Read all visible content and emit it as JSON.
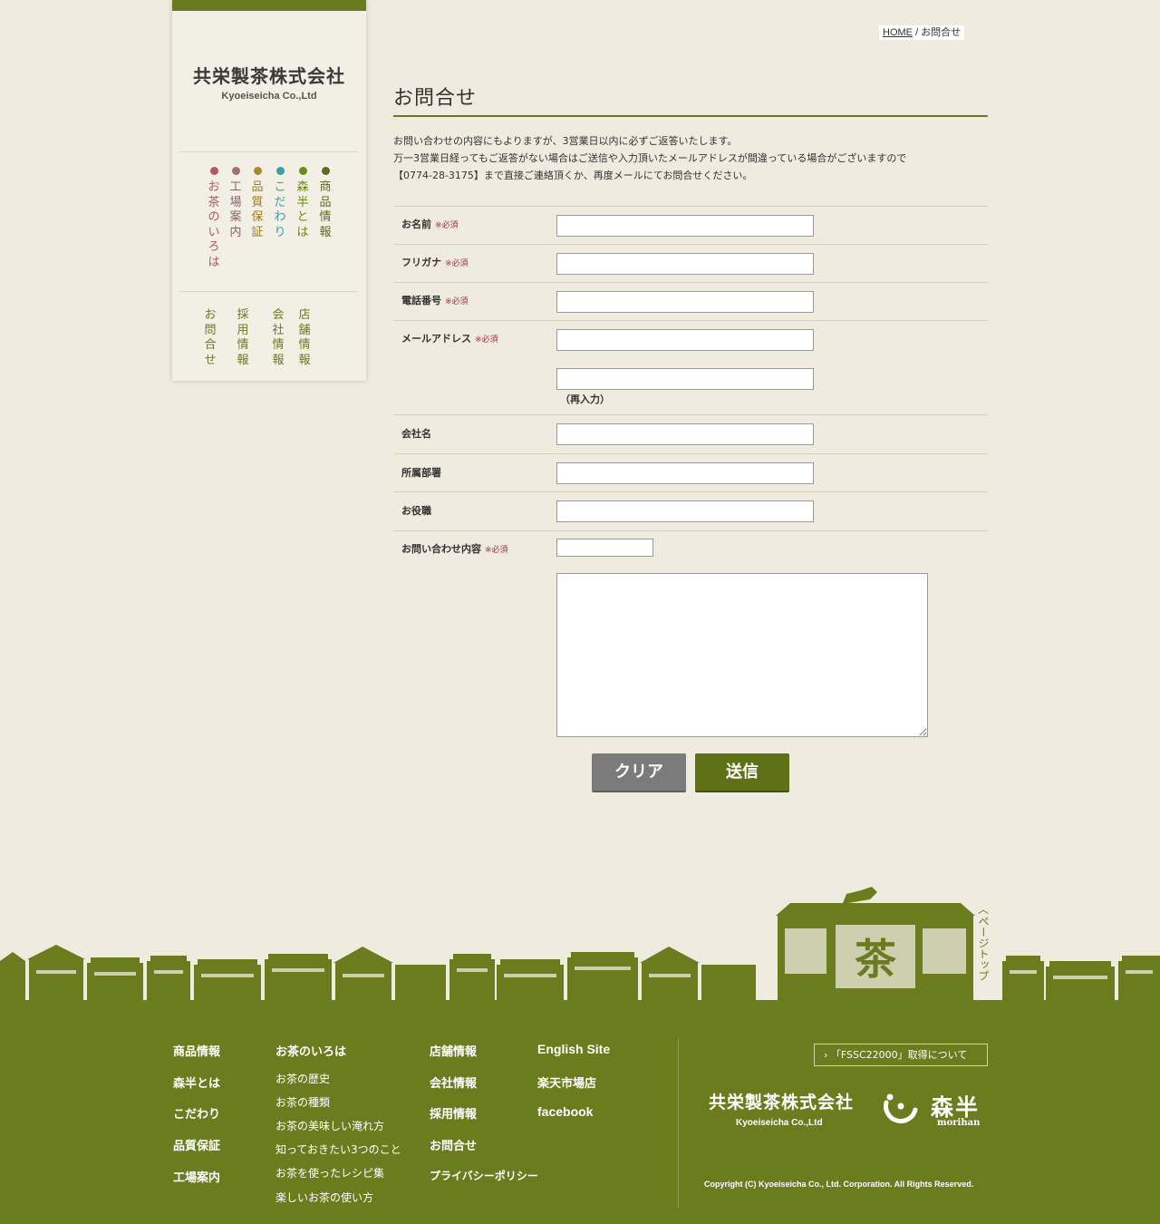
{
  "sidebar": {
    "logo_ja": "共栄製茶株式会社",
    "logo_en": "Kyoeiseicha Co.,Ltd",
    "nav_primary": [
      {
        "label": "お茶のいろは",
        "color": "#b25a5a"
      },
      {
        "label": "工場案内",
        "color": "#a0707a"
      },
      {
        "label": "品質保証",
        "color": "#b08a2a"
      },
      {
        "label": "こだわり",
        "color": "#3aa0a8"
      },
      {
        "label": "森半とは",
        "color": "#6a8a1a"
      },
      {
        "label": "商品情報",
        "color": "#5b6a1f"
      }
    ],
    "nav_secondary": [
      "お問合せ",
      "採用情報",
      "会社情報",
      "店舗情報"
    ]
  },
  "breadcrumb": {
    "home": "HOME",
    "sep": "/",
    "current": "お問合せ"
  },
  "page_title": "お問合せ",
  "intro": [
    "お問い合わせの内容にもよりますが、3営業日以内に必ずご返答いたします。",
    "万一3営業日経ってもご返答がない場合はご送信や入力頂いたメールアドレスが間違っている場合がございますので",
    "【0774-28-3175】まで直接ご連絡頂くか、再度メールにてお問合せください。"
  ],
  "form": {
    "required_mark": "※必須",
    "fields": {
      "name": "お名前",
      "kana": "フリガナ",
      "phone": "電話番号",
      "email": "メールアドレス",
      "reinput": "（再入力）",
      "company": "会社名",
      "department": "所属部署",
      "position": "お役職",
      "inquiry": "お問い合わせ内容"
    },
    "values": {
      "name": "",
      "kana": "",
      "phone": "",
      "email": "",
      "email_confirm": "",
      "company": "",
      "department": "",
      "position": "",
      "inquiry_type": "",
      "message": ""
    },
    "clear_label": "クリア",
    "send_label": "送信"
  },
  "pagetop": "ページトップ",
  "footer": {
    "col1": [
      "商品情報",
      "森半とは",
      "こだわり",
      "品質保証",
      "工場案内"
    ],
    "col2_title": "お茶のいろは",
    "col2": [
      "お茶の歴史",
      "お茶の種類",
      "お茶の美味しい淹れ方",
      "知っておきたい3つのこと",
      "お茶を使ったレシピ集",
      "楽しいお茶の使い方"
    ],
    "col3": [
      "店舗情報",
      "会社情報",
      "採用情報",
      "お問合せ",
      "プライバシーポリシー"
    ],
    "col4": [
      "English Site",
      "楽天市場店",
      "facebook"
    ],
    "fssc": "「FSSC22000」取得について",
    "logo_ja": "共栄製茶株式会社",
    "logo_en": "Kyoeiseicha Co.,Ltd",
    "morihan": "森半",
    "morihan_en": "morihan",
    "copyright": "Copyright (C)  Kyoeiseicha Co., Ltd. Corporation. All Rights Reserved."
  },
  "colors": {
    "brand_green": "#6b7c1f",
    "background": "#efebdf"
  }
}
